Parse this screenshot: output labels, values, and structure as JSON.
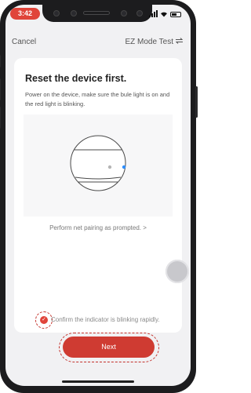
{
  "status_bar": {
    "time": "3:42"
  },
  "navbar": {
    "cancel_label": "Cancel",
    "mode_label": "EZ Mode Test",
    "switch_icon": "swap-icon"
  },
  "card": {
    "title": "Reset the device first.",
    "description": "Power on the device, make sure the bule light is on and the red light is blinking.",
    "link_label": "Perform net pairing as prompted. >"
  },
  "confirm": {
    "label": "Confirm the indicator is blinking rapidly.",
    "checked": true
  },
  "next_button": {
    "label": "Next"
  },
  "colors": {
    "accent": "#cf3b32",
    "time_pill": "#e0443a",
    "indicator_blue": "#2f8fff",
    "indicator_gray": "#b5b5b5"
  }
}
